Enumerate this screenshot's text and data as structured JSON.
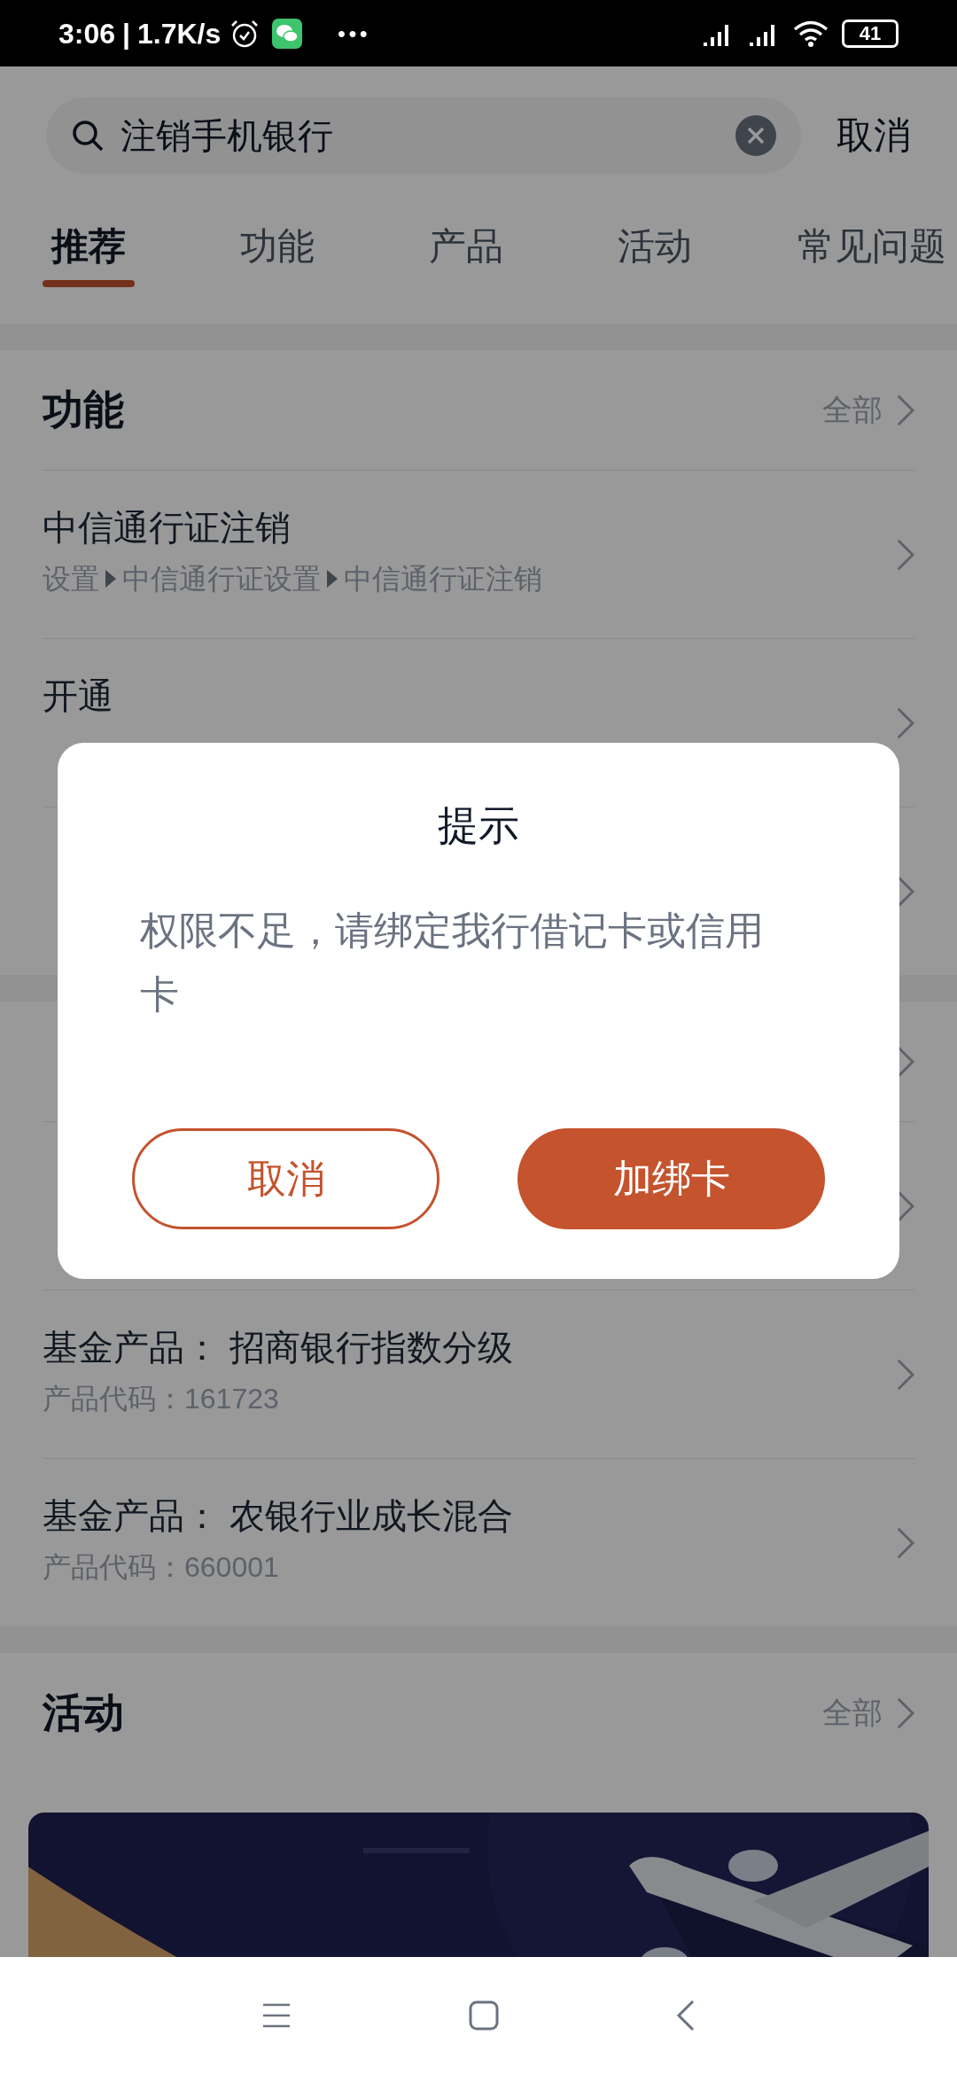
{
  "status_bar": {
    "time": "3:06",
    "separator": "|",
    "speed": "1.7K/s",
    "more": "•••",
    "battery": "41"
  },
  "search": {
    "value": "注销手机银行",
    "cancel": "取消"
  },
  "tabs": [
    {
      "label": "推荐",
      "selected": true
    },
    {
      "label": "功能",
      "selected": false
    },
    {
      "label": "产品",
      "selected": false
    },
    {
      "label": "活动",
      "selected": false
    },
    {
      "label": "常见问题",
      "selected": false
    }
  ],
  "sections": [
    {
      "title": "功能",
      "more": "全部",
      "items": [
        {
          "kind": "row",
          "title": "中信通行证注销",
          "path": [
            "设置",
            "中信通行证设置",
            "中信通行证注销"
          ]
        },
        {
          "kind": "row",
          "title": "开通"
        },
        {
          "kind": "covered"
        }
      ]
    },
    {
      "items": [
        {
          "kind": "covered"
        },
        {
          "kind": "row",
          "title": "基金产品： 招商银行指数分级",
          "code": "产品代码：161723"
        },
        {
          "kind": "row",
          "title": "基金产品： 农银行业成长混合",
          "code": "产品代码：660001"
        }
      ]
    },
    {
      "title": "活动",
      "more": "全部"
    }
  ],
  "dialog": {
    "title": "提示",
    "message": "权限不足，请绑定我行借记卡或信用卡",
    "buttons": [
      {
        "label": "取消",
        "kind": "outline"
      },
      {
        "label": "加绑卡",
        "kind": "primary"
      }
    ]
  }
}
